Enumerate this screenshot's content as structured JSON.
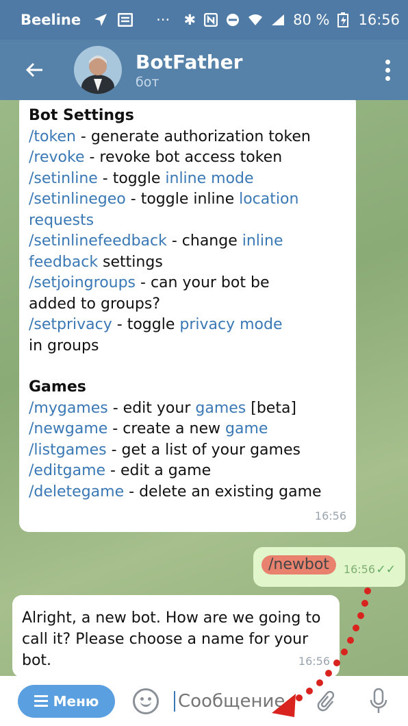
{
  "status": {
    "carrier": "Beeline",
    "dots": "···",
    "battery": "80 %",
    "time": "16:56"
  },
  "header": {
    "title": "BotFather",
    "subtitle": "бот"
  },
  "messages": {
    "settings": {
      "title": "Bot Settings",
      "lines": [
        [
          {
            "t": "/token",
            "c": true
          },
          {
            "t": " - generate authorization token"
          }
        ],
        [
          {
            "t": "/revoke",
            "c": true
          },
          {
            "t": " - revoke bot access token"
          }
        ],
        [
          {
            "t": "/setinline",
            "c": true
          },
          {
            "t": " - toggle "
          },
          {
            "t": "inline mode",
            "c": true
          }
        ],
        [
          {
            "t": "/setinlinegeo",
            "c": true
          },
          {
            "t": " - toggle inline "
          },
          {
            "t": "location",
            "c": true
          }
        ],
        [
          {
            "t": "requests",
            "c": true
          }
        ],
        [
          {
            "t": "/setinlinefeedback",
            "c": true
          },
          {
            "t": " - change "
          },
          {
            "t": "inline",
            "c": true
          }
        ],
        [
          {
            "t": "feedback",
            "c": true
          },
          {
            "t": " settings"
          }
        ],
        [
          {
            "t": "/setjoingroups",
            "c": true
          },
          {
            "t": " - can your bot be"
          }
        ],
        [
          {
            "t": "added to groups?"
          }
        ],
        [
          {
            "t": "/setprivacy",
            "c": true
          },
          {
            "t": " - toggle "
          },
          {
            "t": "privacy mode",
            "c": true
          }
        ],
        [
          {
            "t": "in groups"
          }
        ]
      ],
      "games_title": "Games",
      "games": [
        [
          {
            "t": "/mygames",
            "c": true
          },
          {
            "t": " - edit your "
          },
          {
            "t": "games",
            "c": true
          },
          {
            "t": " [beta]"
          }
        ],
        [
          {
            "t": "/newgame",
            "c": true
          },
          {
            "t": " - create a new "
          },
          {
            "t": "game",
            "c": true
          }
        ],
        [
          {
            "t": "/listgames",
            "c": true
          },
          {
            "t": " - get a list of your games"
          }
        ],
        [
          {
            "t": "/editgame",
            "c": true
          },
          {
            "t": " - edit a game"
          }
        ],
        [
          {
            "t": "/deletegame",
            "c": true
          },
          {
            "t": " - delete an existing game"
          }
        ]
      ],
      "time": "16:56"
    },
    "outgoing": {
      "text": "/newbot",
      "time": "16:56",
      "check": "✓✓"
    },
    "reply": {
      "text": "Alright, a new bot. How are we going to call it? Please choose a name for your bot.",
      "time": "16:56"
    }
  },
  "input": {
    "menu_label": "Меню",
    "placeholder": "Сообщение"
  },
  "colors": {
    "header": "#5682a9",
    "statusbar": "#4f7aa6",
    "link": "#3a78b5",
    "outgoing_bubble": "#e1f7cb",
    "menu_button": "#5aa0e0",
    "annotation": "#d9231e"
  },
  "icons": [
    "back-arrow-icon",
    "more-vert-icon",
    "emoji-icon",
    "attach-icon",
    "mic-icon",
    "read-check-icon"
  ]
}
